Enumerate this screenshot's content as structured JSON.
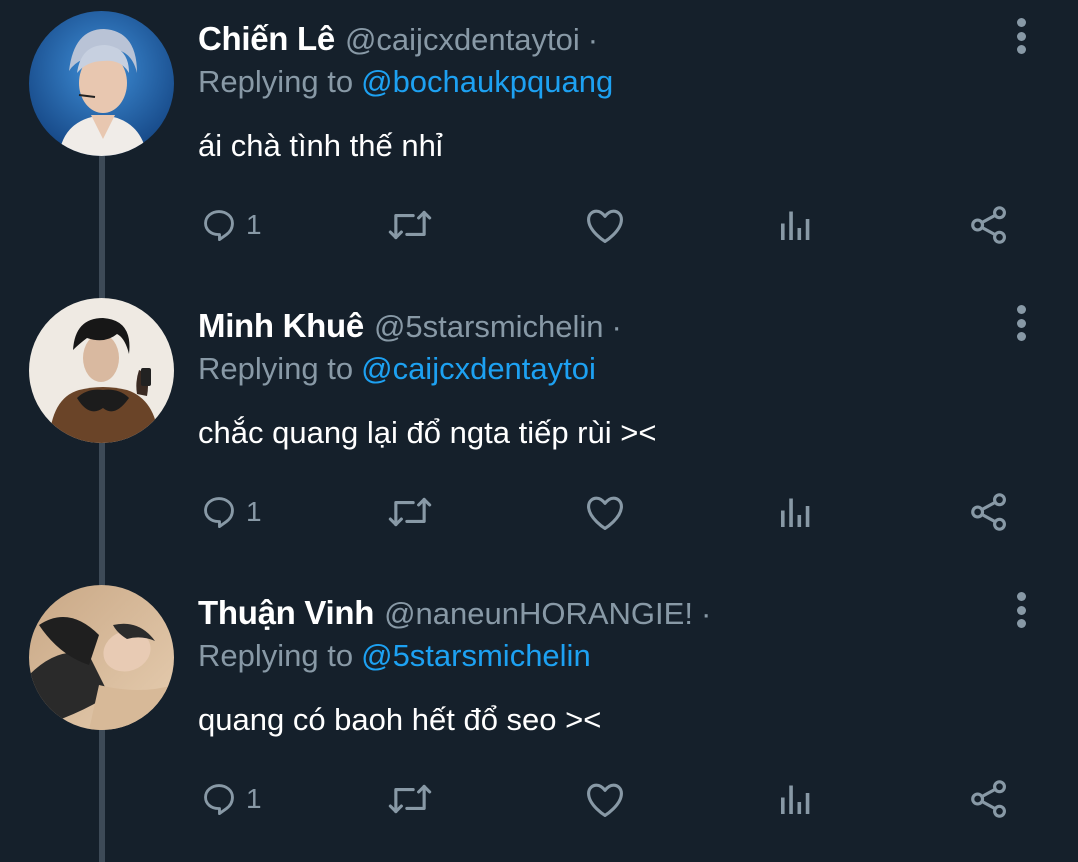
{
  "tweets": [
    {
      "name": "Chiến Lê",
      "handle": "@caijcxdentaytoi",
      "separator": "·",
      "reply_prefix": "Replying to",
      "reply_to": "@bochaukpquang",
      "text": "ái chà tình thế nhỉ",
      "reply_count": "1"
    },
    {
      "name": "Minh Khuê",
      "handle": "@5starsmichelin",
      "separator": "·",
      "reply_prefix": "Replying to",
      "reply_to": "@caijcxdentaytoi",
      "text": "chắc quang lại đổ ngta tiếp rùi ><",
      "reply_count": "1"
    },
    {
      "name": "Thuận Vinh",
      "handle": "@naneunHORANGIE!",
      "separator": "·",
      "reply_prefix": "Replying to",
      "reply_to": "@5starsmichelin",
      "text": "quang có baoh hết đổ seo ><",
      "reply_count": "1"
    }
  ],
  "icons": [
    "reply-icon",
    "retweet-icon",
    "like-icon",
    "analytics-icon",
    "share-icon",
    "more-options-icon"
  ],
  "colors": {
    "background": "#15202b",
    "muted": "#8899a6",
    "link": "#1da1f2",
    "thread_line": "#3d4a57"
  }
}
